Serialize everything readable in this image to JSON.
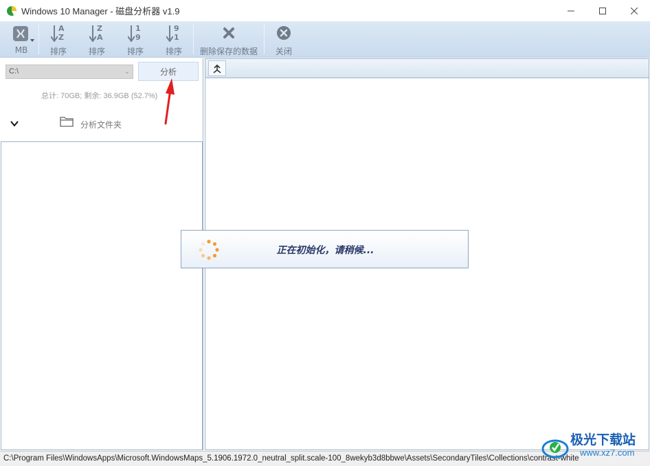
{
  "window": {
    "title": "Windows 10 Manager - 磁盘分析器 v1.9",
    "minimize": "—",
    "maximize": "☐",
    "close": "✕"
  },
  "toolbar": {
    "unit_label": "MB",
    "sort_name_asc": {
      "top": "A",
      "bottom": "Z",
      "label": "排序"
    },
    "sort_name_desc": {
      "top": "Z",
      "bottom": "A",
      "label": "排序"
    },
    "sort_size_asc": {
      "top": "1",
      "bottom": "9",
      "label": "排序"
    },
    "sort_size_desc": {
      "top": "9",
      "bottom": "1",
      "label": "排序"
    },
    "delete_saved_label": "删除保存的数据",
    "close_label": "关闭"
  },
  "left_panel": {
    "drive_value": "C:\\",
    "analyze_button": "分析",
    "disk_info": "总计: 70GB; 剩余: 36.9GB (52.7%)",
    "analyze_folder_label": "分析文件夹"
  },
  "loading": {
    "message": "正在初始化，请稍候..."
  },
  "statusbar": {
    "path": "C:\\Program Files\\WindowsApps\\Microsoft.WindowsMaps_5.1906.1972.0_neutral_split.scale-100_8wekyb3d8bbwe\\Assets\\SecondaryTiles\\Collections\\contrast-white"
  },
  "watermark": {
    "brand": "极光下载站",
    "url": "www.xz7.com"
  },
  "colors": {
    "toolbar_bg": "#d4e3f2",
    "annotation_red": "#e02020",
    "loading_text": "#2b3a67",
    "spinner": "#f59a2e"
  }
}
